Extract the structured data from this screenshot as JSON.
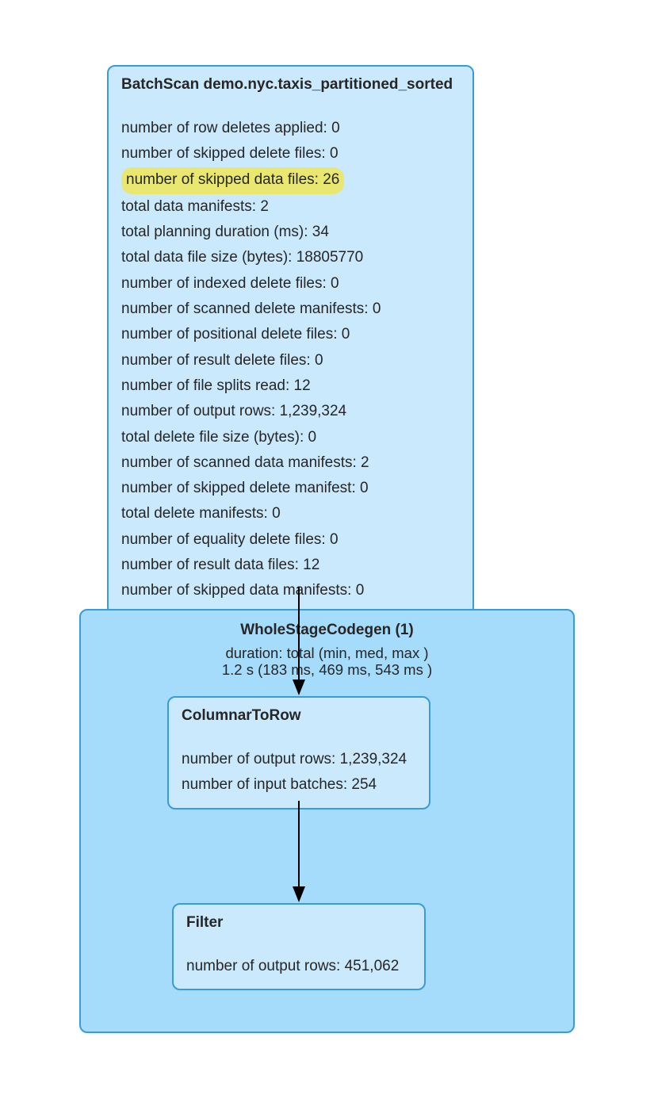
{
  "batchscan": {
    "title": "BatchScan demo.nyc.taxis_partitioned_sorted",
    "metrics": {
      "row_deletes_applied": "number of row deletes applied: 0",
      "skipped_delete_files": "number of skipped delete files: 0",
      "skipped_data_files": "number of skipped data files: 26",
      "total_data_manifests": "total data manifests: 2",
      "planning_duration": "total planning duration (ms): 34",
      "data_file_size": "total data file size (bytes): 18805770",
      "indexed_delete_files": "number of indexed delete files: 0",
      "scanned_delete_manif": "number of scanned delete manifests: 0",
      "positional_delete": "number of positional delete files: 0",
      "result_delete_files": "number of result delete files: 0",
      "file_splits_read": "number of file splits read: 12",
      "output_rows": "number of output rows: 1,239,324",
      "delete_file_size": "total delete file size (bytes): 0",
      "scanned_data_manif": "number of scanned data manifests: 2",
      "skipped_delete_manif": "number of skipped delete manifest: 0",
      "total_delete_manif": "total delete manifests: 0",
      "equality_delete": "number of equality delete files: 0",
      "result_data_files": "number of result data files: 12",
      "skipped_data_manif": "number of skipped data manifests: 0"
    }
  },
  "stage": {
    "title": "WholeStageCodegen (1)",
    "sub1": "duration: total (min, med, max )",
    "sub2": "1.2 s (183 ms, 469 ms, 543 ms )"
  },
  "columnar": {
    "title": "ColumnarToRow",
    "output_rows": "number of output rows: 1,239,324",
    "input_batches": "number of input batches: 254"
  },
  "filter": {
    "title": "Filter",
    "output_rows": "number of output rows: 451,062"
  }
}
